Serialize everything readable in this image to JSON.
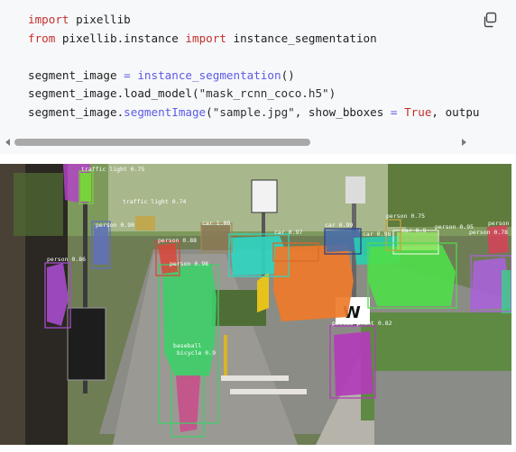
{
  "code": {
    "line1": {
      "kw": "import",
      "rest": " pixellib"
    },
    "line2": {
      "kw_from": "from",
      "module": " pixellib.instance ",
      "kw_import": "import",
      "name": " instance_segmentation"
    },
    "line3": {
      "var": "segment_image ",
      "op": "=",
      "call": " instance_segmentation",
      "rest": "()"
    },
    "line4": {
      "prefix": "segment_image.load_model(",
      "arg": "\"mask_rcnn_coco.h5\"",
      "suffix": ")"
    },
    "line5": {
      "prefix": "segment_image.",
      "method": "segmentImage",
      "paren": "(",
      "arg": "\"sample.jpg\"",
      "mid": ", show_bboxes ",
      "op": "=",
      "val": " True",
      "tail": ", outpu"
    }
  },
  "toolbar": {
    "copy_icon": "copy-icon"
  },
  "scrollbar": {
    "position_fraction": 0.0,
    "visible_fraction": 0.67
  },
  "image": {
    "labels": {
      "traffic_light_1": "traffic light 0.75",
      "traffic_light_2": "traffic light 0.74",
      "person_1": "person 0.90",
      "person_2": "person 0.86",
      "person_3": "person 0.88",
      "person_4": "person 0.75",
      "person_5": "person 0.95",
      "person_6": "person 0.78",
      "person_7": "person 0.98",
      "person_8": "person",
      "car_1": "car 1.00",
      "car_2": "car 0.97",
      "car_3": "car 0.99",
      "car_4": "car 0.98",
      "car_5": "car 0.9",
      "baseball": "baseball",
      "potted_plant": "potted plant 0.82",
      "bicycle": "bicycle 0.9"
    },
    "sign_text": "W"
  }
}
